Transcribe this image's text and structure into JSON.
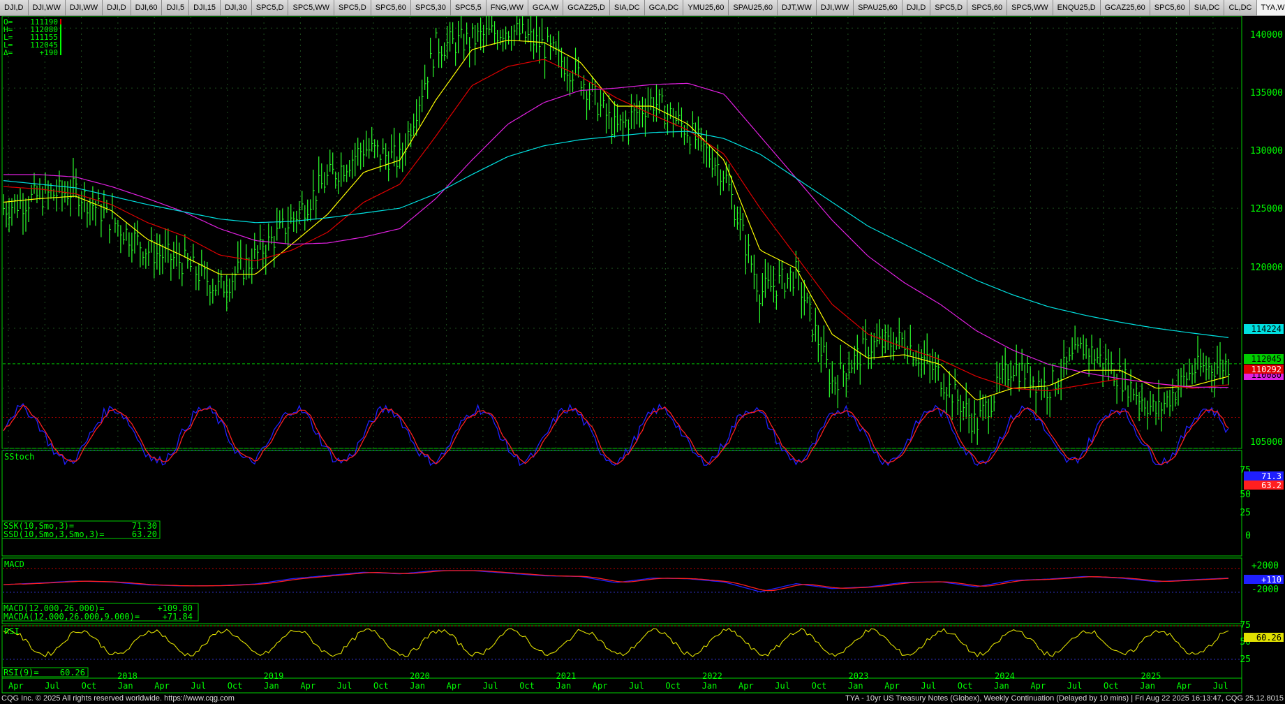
{
  "tabs": [
    "DJI,D",
    "DJI,WW",
    "DJI,WW",
    "DJI,D",
    "DJI,60",
    "DJI,5",
    "DJI,15",
    "DJI,30",
    "SPC5,D",
    "SPC5,WW",
    "SPC5,D",
    "SPC5,60",
    "SPC5,30",
    "SPC5,5",
    "FNG,WW",
    "GCA,W",
    "GCAZ25,D",
    "SIA,DC",
    "GCA,DC",
    "YMU25,60",
    "SPAU25,60",
    "DJT,WW",
    "DJI,WW",
    "SPAU25,60",
    "DJI,D",
    "SPC5,D",
    "SPC5,60",
    "SPC5,WW",
    "ENQU25,D",
    "GCAZ25,60",
    "SPC5,60",
    "SIA,DC",
    "CL,DC",
    "TYA,W",
    "+"
  ],
  "active_tab": "TYA,W",
  "colors": {
    "price": "#2cff2c",
    "ma_yellow": "#ffff00",
    "ma_red": "#e00000",
    "ma_magenta": "#e020e0",
    "ma_cyan": "#00e0e0",
    "stoch_k": "#1f1fff",
    "stoch_d": "#ff1f1f",
    "rsi": "#e0e000",
    "frame": "#00d000"
  },
  "ohlc": {
    "open_label": "O=",
    "open": "111190",
    "high_label": "H=",
    "high": "112080",
    "low_label": "L=",
    "low": "111155",
    "last_label": "L=",
    "last": "112045",
    "change_label": "Δ=",
    "change": "+190"
  },
  "price_axis": [
    "140000",
    "135000",
    "130000",
    "125000",
    "120000",
    "105000"
  ],
  "price_tags": {
    "cyan": "114224",
    "last": "112045",
    "red": "110292",
    "magenta": "110080"
  },
  "stoch": {
    "title": "SStoch",
    "axis": [
      "75",
      "50",
      "25",
      "0"
    ],
    "legend_k": "SSK(10,Smo,3)=",
    "value_k": "71.30",
    "legend_d": "SSD(10,Smo,3,Smo,3)=",
    "value_d": "63.20",
    "tag_k": "71.3",
    "tag_d": "63.2"
  },
  "macd": {
    "title": "MACD",
    "axis": [
      "+2000",
      "-2000"
    ],
    "legend_macd": "MACD(12.000,26.000)=",
    "value_macd": "+109.80",
    "legend_signal": "MACDA(12.000,26.000,9.000)=",
    "value_signal": "+71.84",
    "tag": "+110"
  },
  "rsi": {
    "title": "RSI",
    "axis": [
      "75",
      "50",
      "25"
    ],
    "legend": "RSI(9)=",
    "value": "60.26",
    "tag": "60.26"
  },
  "time_axis": {
    "years": [
      "2018",
      "2019",
      "2020",
      "2021",
      "2022",
      "2023",
      "2024",
      "2025"
    ],
    "months": [
      "Apr",
      "Jul",
      "Oct",
      "Jan",
      "Apr",
      "Jul",
      "Oct",
      "Jan",
      "Apr",
      "Jul",
      "Oct",
      "Jan",
      "Apr",
      "Jul",
      "Oct",
      "Jan",
      "Apr",
      "Jul",
      "Oct",
      "Jan",
      "Apr",
      "Jul",
      "Oct",
      "Jan",
      "Apr",
      "Jul",
      "Oct",
      "Jan",
      "Apr",
      "Jul",
      "Oct",
      "Jan",
      "Apr",
      "Jul"
    ]
  },
  "status": {
    "left": "CQG Inc. © 2025 All rights reserved worldwide. https://www.cqg.com",
    "right": "TYA - 10yr US Treasury Notes (Globex), Weekly Continuation (Delayed by 10 mins) | Fri Aug 22 2025 16:13:47, CQG 25.12.8015"
  },
  "chart_data": {
    "type": "line",
    "instrument": "TYA - 10yr US Treasury Notes (Globex), Weekly Continuation",
    "x": [
      "2017-04",
      "2017-07",
      "2017-10",
      "2018-01",
      "2018-04",
      "2018-07",
      "2018-10",
      "2019-01",
      "2019-04",
      "2019-07",
      "2019-10",
      "2020-01",
      "2020-03",
      "2020-06",
      "2020-08",
      "2020-10",
      "2021-01",
      "2021-04",
      "2021-07",
      "2021-10",
      "2022-01",
      "2022-04",
      "2022-07",
      "2022-10",
      "2023-01",
      "2023-03",
      "2023-06",
      "2023-10",
      "2024-01",
      "2024-04",
      "2024-07",
      "2024-10",
      "2025-01",
      "2025-04",
      "2025-08"
    ],
    "series": [
      {
        "name": "price",
        "values": [
          125000,
          126000,
          126500,
          124000,
          121500,
          120500,
          118300,
          121000,
          124000,
          127500,
          130000,
          129000,
          138500,
          139000,
          140000,
          138500,
          136000,
          131500,
          134000,
          131500,
          128000,
          118000,
          119500,
          110500,
          113500,
          114000,
          111000,
          107000,
          112000,
          110000,
          113500,
          111000,
          108000,
          111500,
          112045
        ]
      },
      {
        "name": "ma_yellow",
        "values": [
          125500,
          125800,
          126000,
          124800,
          122400,
          121000,
          119500,
          119500,
          122000,
          124500,
          128000,
          129000,
          134000,
          138200,
          139000,
          138800,
          137200,
          133500,
          133500,
          132000,
          129000,
          121500,
          120000,
          114500,
          112500,
          112800,
          112000,
          109000,
          110000,
          110200,
          111500,
          111500,
          110000,
          110200,
          111000
        ]
      },
      {
        "name": "ma_red",
        "values": [
          126800,
          126600,
          126200,
          125300,
          123800,
          122700,
          121100,
          120600,
          121500,
          123000,
          125500,
          127000,
          131000,
          135200,
          136800,
          137400,
          136000,
          134200,
          132800,
          131500,
          129500,
          125000,
          121000,
          117000,
          114500,
          113400,
          112400,
          111000,
          110000,
          109800,
          110300,
          110800,
          110400,
          110000,
          110292
        ]
      },
      {
        "name": "ma_magenta",
        "values": [
          127800,
          127800,
          127600,
          126800,
          125800,
          124700,
          123300,
          122300,
          122000,
          122100,
          122600,
          123300,
          125800,
          129000,
          132000,
          133800,
          134800,
          135000,
          135300,
          135400,
          134500,
          131000,
          127500,
          124000,
          121000,
          118800,
          117000,
          114800,
          113200,
          112000,
          111300,
          110800,
          110400,
          110100,
          110080
        ]
      },
      {
        "name": "ma_cyan",
        "values": [
          127300,
          127000,
          126700,
          126000,
          125300,
          124700,
          124100,
          123800,
          123900,
          124200,
          124600,
          125000,
          126200,
          127800,
          129300,
          130200,
          130700,
          131000,
          131300,
          131400,
          130800,
          129500,
          127500,
          125500,
          123500,
          122000,
          120500,
          119000,
          117800,
          116800,
          116100,
          115500,
          115000,
          114600,
          114224
        ]
      }
    ],
    "ylim": [
      105000,
      141000
    ]
  }
}
